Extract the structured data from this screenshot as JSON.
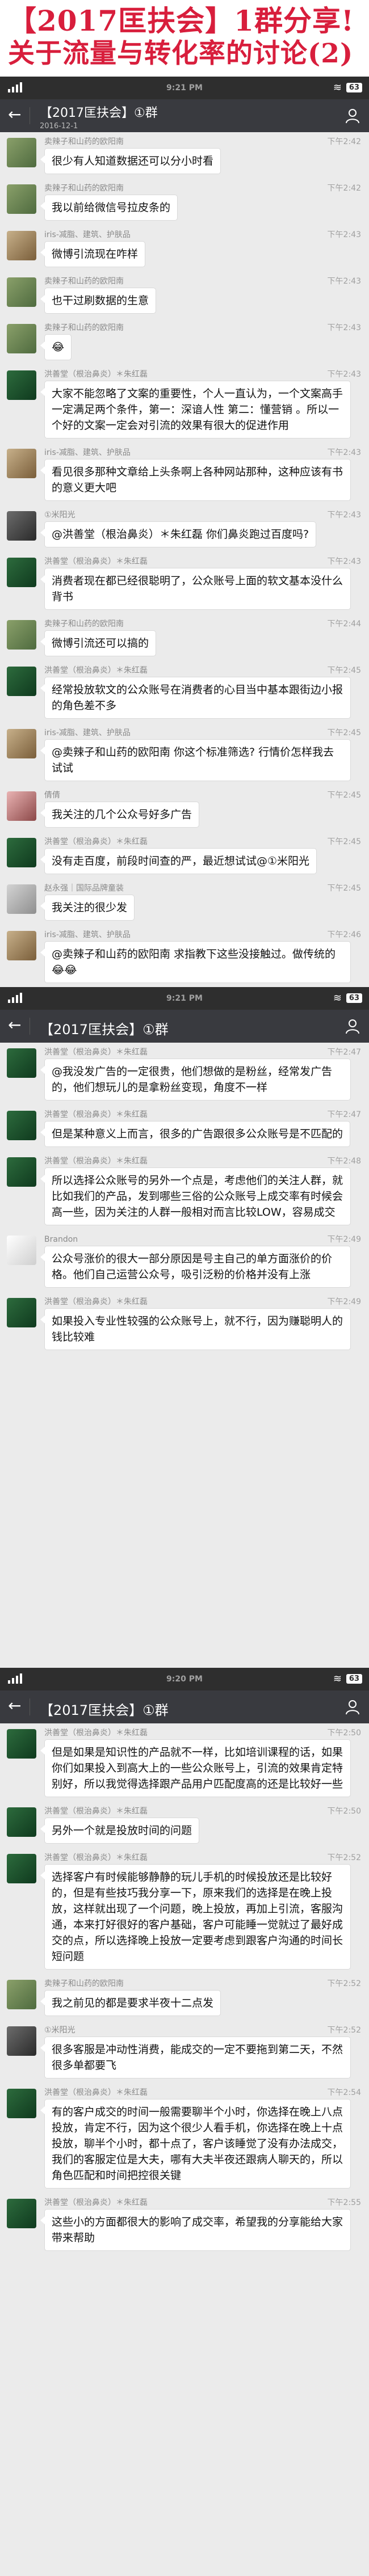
{
  "banner": {
    "line1": "【2017匡扶会】1群分享!",
    "line2": "关于流量与转化率的讨论(2)"
  },
  "status": {
    "time1": "9:21 PM",
    "time2": "9:21 PM",
    "time3": "9:20 PM",
    "wifi_icon": "wifi-icon",
    "battery": "63"
  },
  "chat": {
    "title": "【2017匡扶会】①群",
    "date_sub": "2016-12-1",
    "back_icon": "back-arrow-icon",
    "member_icon": "person-icon"
  },
  "panel1": [
    {
      "name": "卖辣子和山药的欧阳南",
      "time": "下午2:42",
      "text": "很少有人知道数据还可以分小时看"
    },
    {
      "name": "卖辣子和山药的欧阳南",
      "time": "下午2:42",
      "text": "我以前给微信号拉皮条的"
    },
    {
      "name": "iris-减脂、建筑、护肤品",
      "time": "下午2:43",
      "text": "微博引流现在咋样"
    },
    {
      "name": "卖辣子和山药的欧阳南",
      "time": "下午2:43",
      "text": "也干过刷数据的生意"
    },
    {
      "name": "卖辣子和山药的欧阳南",
      "time": "下午2:43",
      "text": "😂"
    },
    {
      "name": "洪善堂（根治鼻炎）＊朱红磊",
      "time": "下午2:43",
      "text": "大家不能忽略了文案的重要性，个人一直认为，一个文案高手一定满足两个条件，第一：深谙人性 第二：懂营销 。所以一个好的文案一定会对引流的效果有很大的促进作用"
    },
    {
      "name": "iris-减脂、建筑、护肤品",
      "time": "下午2:43",
      "text": "看见很多那种文章给上头条啊上各种网站那种，这种应该有书的意义更大吧"
    },
    {
      "name": "①米阳光",
      "time": "下午2:43",
      "text": "@洪善堂（根治鼻炎）＊朱红磊 你们鼻炎跑过百度吗?"
    },
    {
      "name": "洪善堂（根治鼻炎）＊朱红磊",
      "time": "下午2:43",
      "text": "消费者现在都已经很聪明了，公众账号上面的软文基本没什么背书"
    },
    {
      "name": "卖辣子和山药的欧阳南",
      "time": "下午2:44",
      "text": "微博引流还可以搞的"
    },
    {
      "name": "洪善堂（根治鼻炎）＊朱红磊",
      "time": "下午2:45",
      "text": "经常投放软文的公众账号在消费者的心目当中基本跟街边小报的角色差不多"
    },
    {
      "name": "iris-减脂、建筑、护肤品",
      "time": "下午2:45",
      "text": "@卖辣子和山药的欧阳南 你这个标准筛选? 行情价怎样我去试试"
    },
    {
      "name": "倩倩",
      "time": "下午2:45",
      "text": "我关注的几个公众号好多广告"
    },
    {
      "name": "洪善堂（根治鼻炎）＊朱红磊",
      "time": "下午2:45",
      "text": "没有走百度，前段时间查的严，最近想试试@①米阳光"
    },
    {
      "name": "赵永强｜国际品牌童装",
      "time": "下午2:45",
      "text": "我关注的很少发"
    },
    {
      "name": "iris-减脂、建筑、护肤品",
      "time": "下午2:46",
      "text": "@卖辣子和山药的欧阳南 求指教下这些没接触过。做传统的😂😂"
    }
  ],
  "panel2": [
    {
      "name": "洪善堂（根治鼻炎）＊朱红磊",
      "time": "下午2:47",
      "text": "@我没发广告的一定很贵，他们想做的是粉丝，经常发广告的，他们想玩儿的是拿粉丝变现，角度不一样"
    },
    {
      "name": "洪善堂（根治鼻炎）＊朱红磊",
      "time": "下午2:47",
      "text": "但是某种意义上而言，很多的广告跟很多公众账号是不匹配的"
    },
    {
      "name": "洪善堂（根治鼻炎）＊朱红磊",
      "time": "下午2:48",
      "text": "所以选择公众账号的另外一个点是，考虑他们的关注人群，就比如我们的产品，发到哪些三俗的公众账号上成交率有时候会高一些，因为关注的人群一般相对而言比较LOW，容易成交"
    },
    {
      "name": "Brandon",
      "time": "下午2:49",
      "text": "公众号涨价的很大一部分原因是号主自己的单方面涨价的价格。他们自己运营公众号，吸引泛粉的价格并没有上涨"
    },
    {
      "name": "洪善堂（根治鼻炎）＊朱红磊",
      "time": "下午2:49",
      "text": "如果投入专业性较强的公众账号上，就不行，因为赚聪明人的钱比较难"
    }
  ],
  "panel3": [
    {
      "name": "洪善堂（根治鼻炎）＊朱红磊",
      "time": "下午2:50",
      "text": "但是如果是知识性的产品就不一样，比如培训课程的话，如果你们如果投入到高大上的一些公众账号上，引流的效果肯定特别好，所以我觉得选择跟产品用户匹配度高的还是比较好一些"
    },
    {
      "name": "洪善堂（根治鼻炎）＊朱红磊",
      "time": "下午2:50",
      "text": "另外一个就是投放时间的问题"
    },
    {
      "name": "洪善堂（根治鼻炎）＊朱红磊",
      "time": "下午2:52",
      "text": "选择客户有时候能够静静的玩儿手机的时候投放还是比较好的，但是有些技巧我分享一下，原来我们的选择是在晚上投放，这样就出现了一个问题，晚上投放，再加上引流，客服沟通，本来打好很好的客户基础，客户可能睡一觉就过了最好成交的点，所以选择晚上投放一定要考虑到跟客户沟通的时间长短问题"
    },
    {
      "name": "卖辣子和山药的欧阳南",
      "time": "下午2:52",
      "text": "我之前见的都是要求半夜十二点发"
    },
    {
      "name": "①米阳光",
      "time": "下午2:52",
      "text": "很多客服是冲动性消费，能成交的一定不要拖到第二天，不然很多单都要飞"
    },
    {
      "name": "洪善堂（根治鼻炎）＊朱红磊",
      "time": "下午2:54",
      "text": "有的客户成交的时间一般需要聊半个小时，你选择在晚上八点投放，肯定不行，因为这个很少人看手机，你选择在晚上十点投放，聊半个小时，都十点了，客户该睡觉了没有办法成交，我们的客服定位是大夫，哪有大夫半夜还跟病人聊天的，所以角色匹配和时间把控很关键"
    },
    {
      "name": "洪善堂（根治鼻炎）＊朱红磊",
      "time": "下午2:55",
      "text": "这些小的方面都很大的影响了成交率，希望我的分享能给大家带来帮助"
    }
  ]
}
